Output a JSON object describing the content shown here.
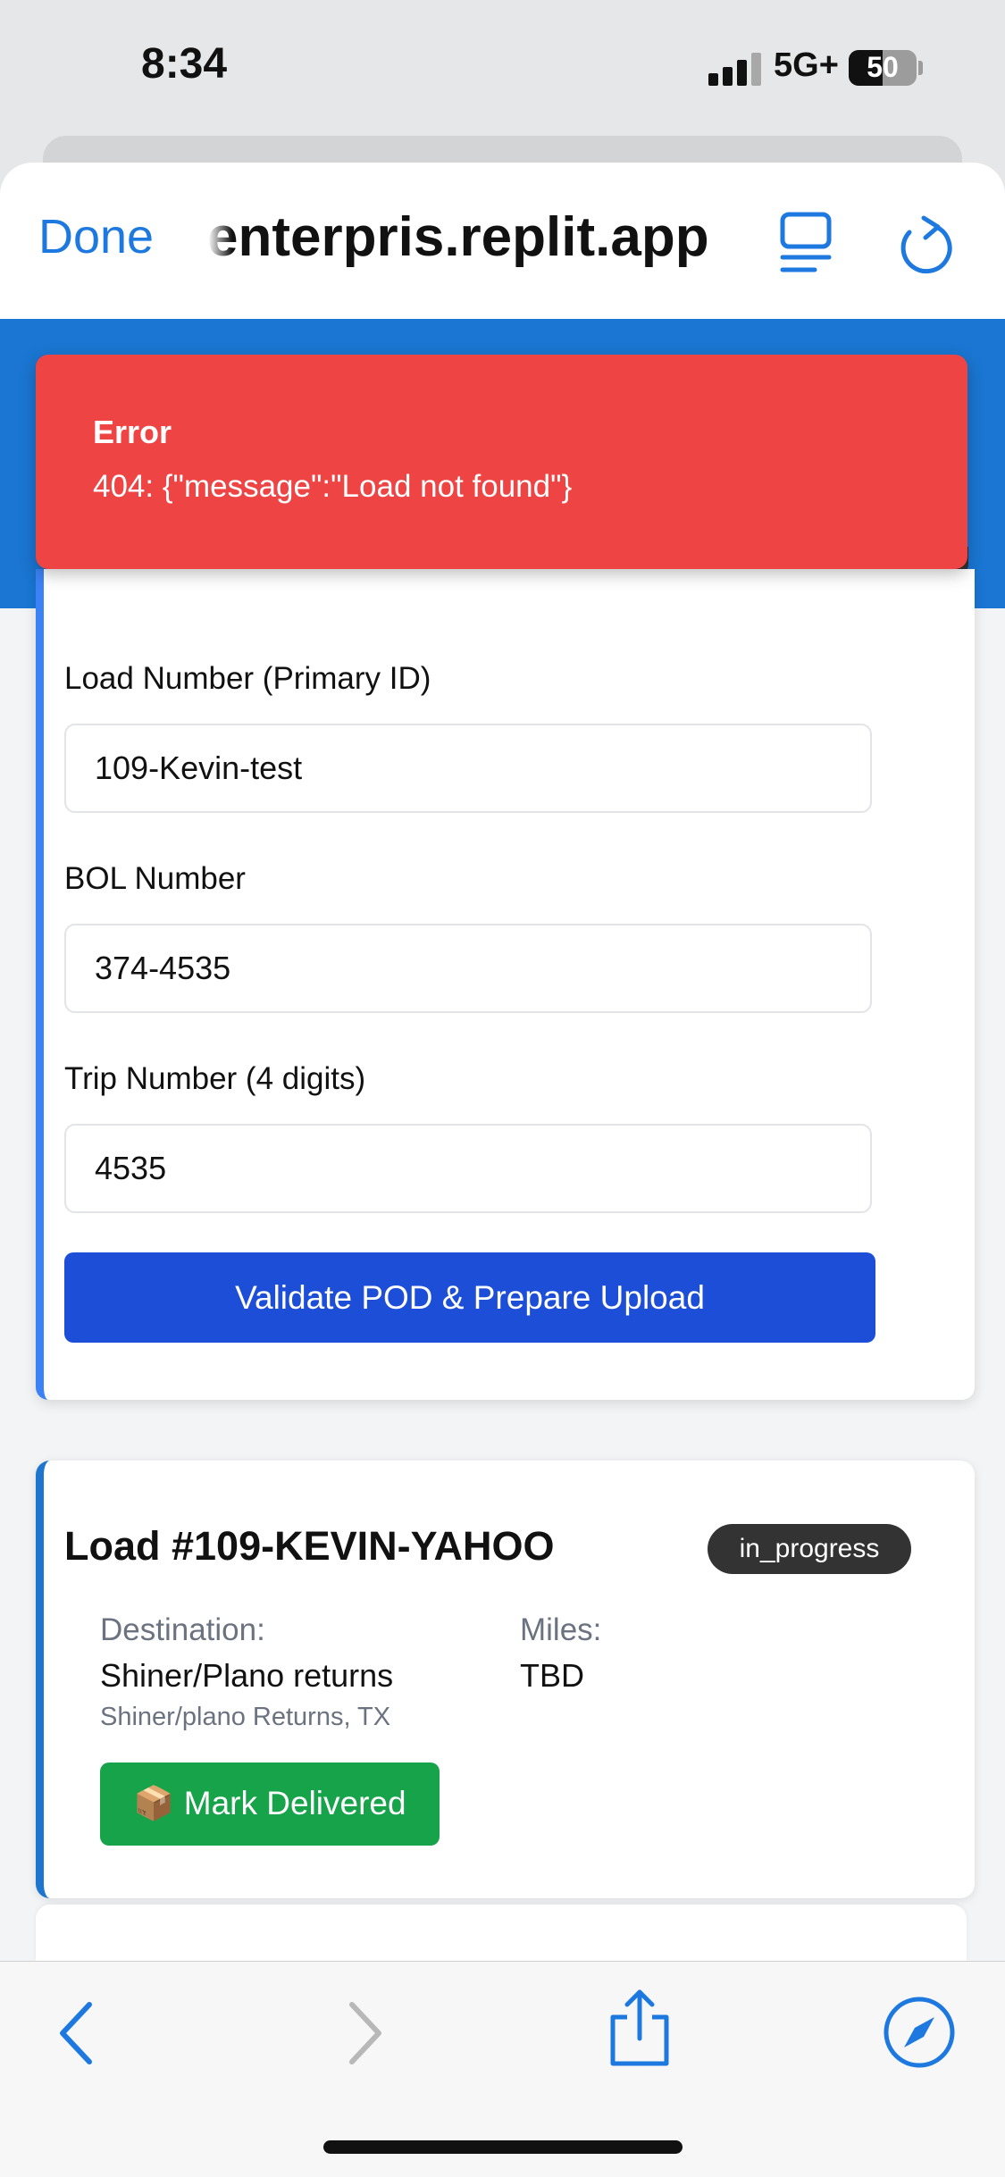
{
  "status_bar": {
    "time": "8:34",
    "network": "5G+",
    "battery": "50"
  },
  "browser": {
    "done_label": "Done",
    "url": "enterpris.replit.app"
  },
  "error": {
    "title": "Error",
    "message": "404: {\"message\":\"Load not found\"}"
  },
  "form": {
    "load_number": {
      "label": "Load Number (Primary ID)",
      "value": "109-Kevin-test"
    },
    "bol_number": {
      "label": "BOL Number",
      "value": "374-4535"
    },
    "trip_number": {
      "label": "Trip Number (4 digits)",
      "value": "4535"
    },
    "submit_label": "Validate POD & Prepare Upload"
  },
  "load": {
    "title": "Load #109-KEVIN-YAHOO",
    "status": "in_progress",
    "destination_label": "Destination:",
    "destination": "Shiner/Plano returns",
    "destination_sub": "Shiner/plano Returns, TX",
    "miles_label": "Miles:",
    "miles": "TBD",
    "deliver_label": "📦 Mark Delivered"
  },
  "colors": {
    "accent": "#1a76d2",
    "error": "#ef4444",
    "primary_button": "#1d4ed8",
    "success_button": "#16a34a",
    "ios_blue": "#1d78e0"
  },
  "toolbar": {
    "icons": [
      "back-icon",
      "forward-icon",
      "share-icon",
      "compass-icon"
    ]
  }
}
